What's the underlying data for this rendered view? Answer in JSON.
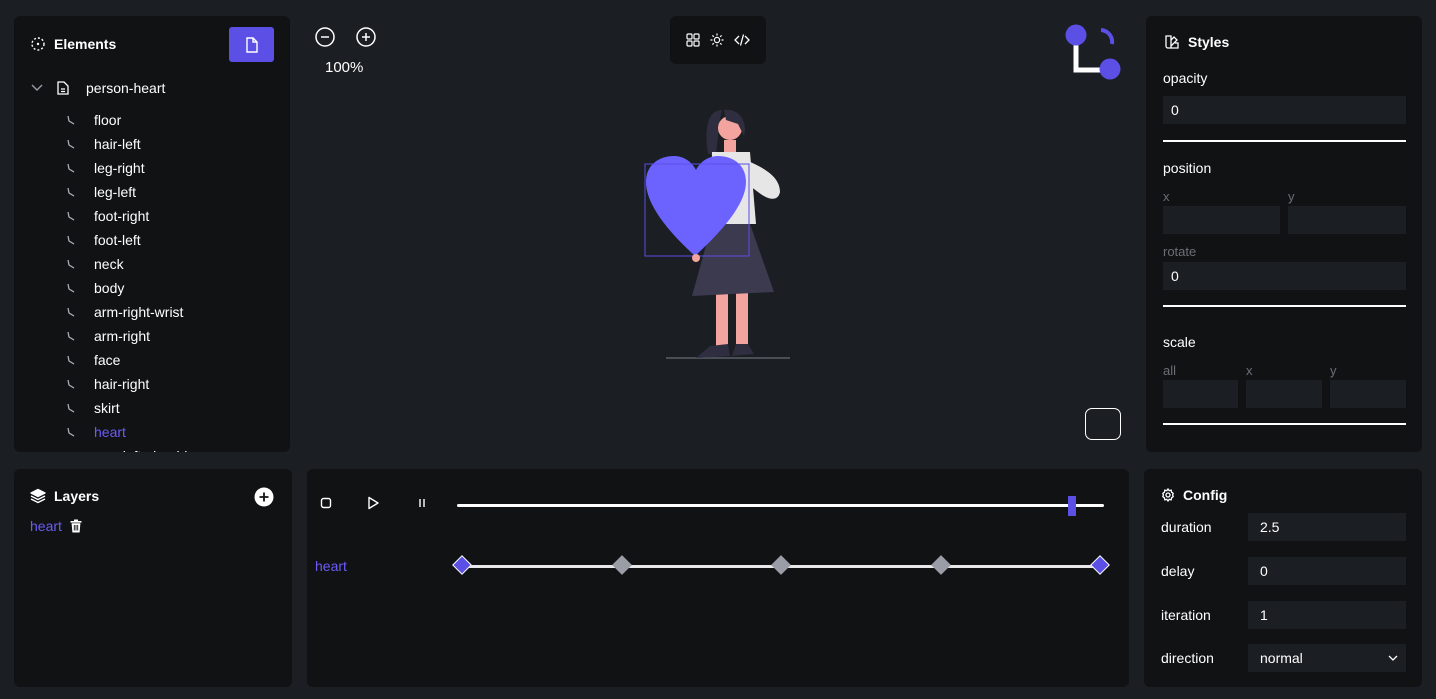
{
  "elements": {
    "title": "Elements",
    "root": "person-heart",
    "items": [
      {
        "label": "floor"
      },
      {
        "label": "hair-left"
      },
      {
        "label": "leg-right"
      },
      {
        "label": "leg-left"
      },
      {
        "label": "foot-right"
      },
      {
        "label": "foot-left"
      },
      {
        "label": "neck"
      },
      {
        "label": "body"
      },
      {
        "label": "arm-right-wrist"
      },
      {
        "label": "arm-right"
      },
      {
        "label": "face"
      },
      {
        "label": "hair-right"
      },
      {
        "label": "skirt"
      },
      {
        "label": "heart"
      },
      {
        "label": "arm-left-shoulder"
      }
    ],
    "active_item": "heart"
  },
  "canvas": {
    "zoom": "100%"
  },
  "styles": {
    "title": "Styles",
    "opacity": {
      "label": "opacity",
      "value": "0"
    },
    "position": {
      "label": "position",
      "x_label": "x",
      "x_value": "",
      "y_label": "y",
      "y_value": "",
      "rotate_label": "rotate",
      "rotate_value": "0"
    },
    "scale": {
      "label": "scale",
      "all_label": "all",
      "all_value": "",
      "x_label": "x",
      "x_value": "",
      "y_label": "y",
      "y_value": ""
    }
  },
  "layers": {
    "title": "Layers",
    "items": [
      {
        "name": "heart"
      }
    ]
  },
  "timeline": {
    "progress": 0.95,
    "track_label": "heart",
    "keyframes": [
      0,
      0.25,
      0.5,
      0.75,
      1
    ]
  },
  "config": {
    "title": "Config",
    "duration_label": "duration",
    "duration_value": "2.5",
    "delay_label": "delay",
    "delay_value": "0",
    "iteration_label": "iteration",
    "iteration_value": "1",
    "direction_label": "direction",
    "direction_value": "normal"
  },
  "colors": {
    "accent": "#5b4fe6",
    "accent_text": "#6b5cf5",
    "panel": "#111214",
    "background": "#1b1e22"
  }
}
